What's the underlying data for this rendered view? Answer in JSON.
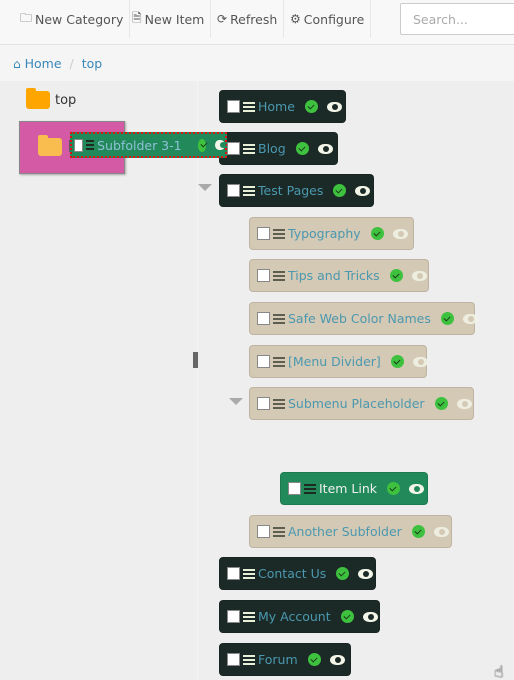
{
  "toolbar": {
    "new_category": {
      "label": "New Category",
      "icon": "folder-outline-icon"
    },
    "new_item": {
      "label": "New Item",
      "icon": "file-text-icon"
    },
    "refresh": {
      "label": "Refresh",
      "icon": "refresh-icon"
    },
    "configure": {
      "label": "Configure",
      "icon": "gear-icon"
    },
    "search": {
      "placeholder": "Search...",
      "value": ""
    }
  },
  "breadcrumb": {
    "home": "Home",
    "current": "top",
    "separator": "/"
  },
  "category_tree": {
    "root": "top",
    "drop_target_label_fragment": "["
  },
  "dragging_item": {
    "label": "Subfolder 3-1",
    "published": true,
    "visible": true
  },
  "menu_items": [
    {
      "label": "Home",
      "style": "dark",
      "level": 0,
      "published": true,
      "visible": true
    },
    {
      "label": "Blog",
      "style": "dark",
      "level": 0,
      "published": true,
      "visible": true
    },
    {
      "label": "Test Pages",
      "style": "dark",
      "level": 0,
      "expanded": true,
      "published": true,
      "visible": true
    },
    {
      "label": "Typography",
      "style": "tan",
      "level": 1,
      "published": true,
      "visible": true
    },
    {
      "label": "Tips and Tricks",
      "style": "tan",
      "level": 1,
      "published": true,
      "visible": true
    },
    {
      "label": "Safe Web Color Names",
      "style": "tan",
      "level": 1,
      "published": true,
      "visible": true
    },
    {
      "label": "[Menu Divider]",
      "style": "tan",
      "level": 1,
      "published": true,
      "visible": true
    },
    {
      "label": "Submenu Placeholder",
      "style": "tan",
      "level": 1,
      "expanded": true,
      "published": true,
      "visible": true
    },
    {
      "label": "Item Link",
      "style": "green",
      "level": 2,
      "published": true,
      "visible": true
    },
    {
      "label": "Another Subfolder",
      "style": "tan",
      "level": 1,
      "published": true,
      "visible": true
    },
    {
      "label": "Contact Us",
      "style": "dark",
      "level": 0,
      "published": true,
      "visible": true
    },
    {
      "label": "My Account",
      "style": "dark",
      "level": 0,
      "published": true,
      "visible": true
    },
    {
      "label": "Forum",
      "style": "dark",
      "level": 0,
      "published": true,
      "visible": true
    }
  ],
  "colors": {
    "dark_item": "#1b2a26",
    "tan_item": "#d4c9b4",
    "green_item": "#228a5a",
    "drop_target": "#d55aa6",
    "link": "#3a87b8",
    "published_check": "#3ec13e"
  }
}
